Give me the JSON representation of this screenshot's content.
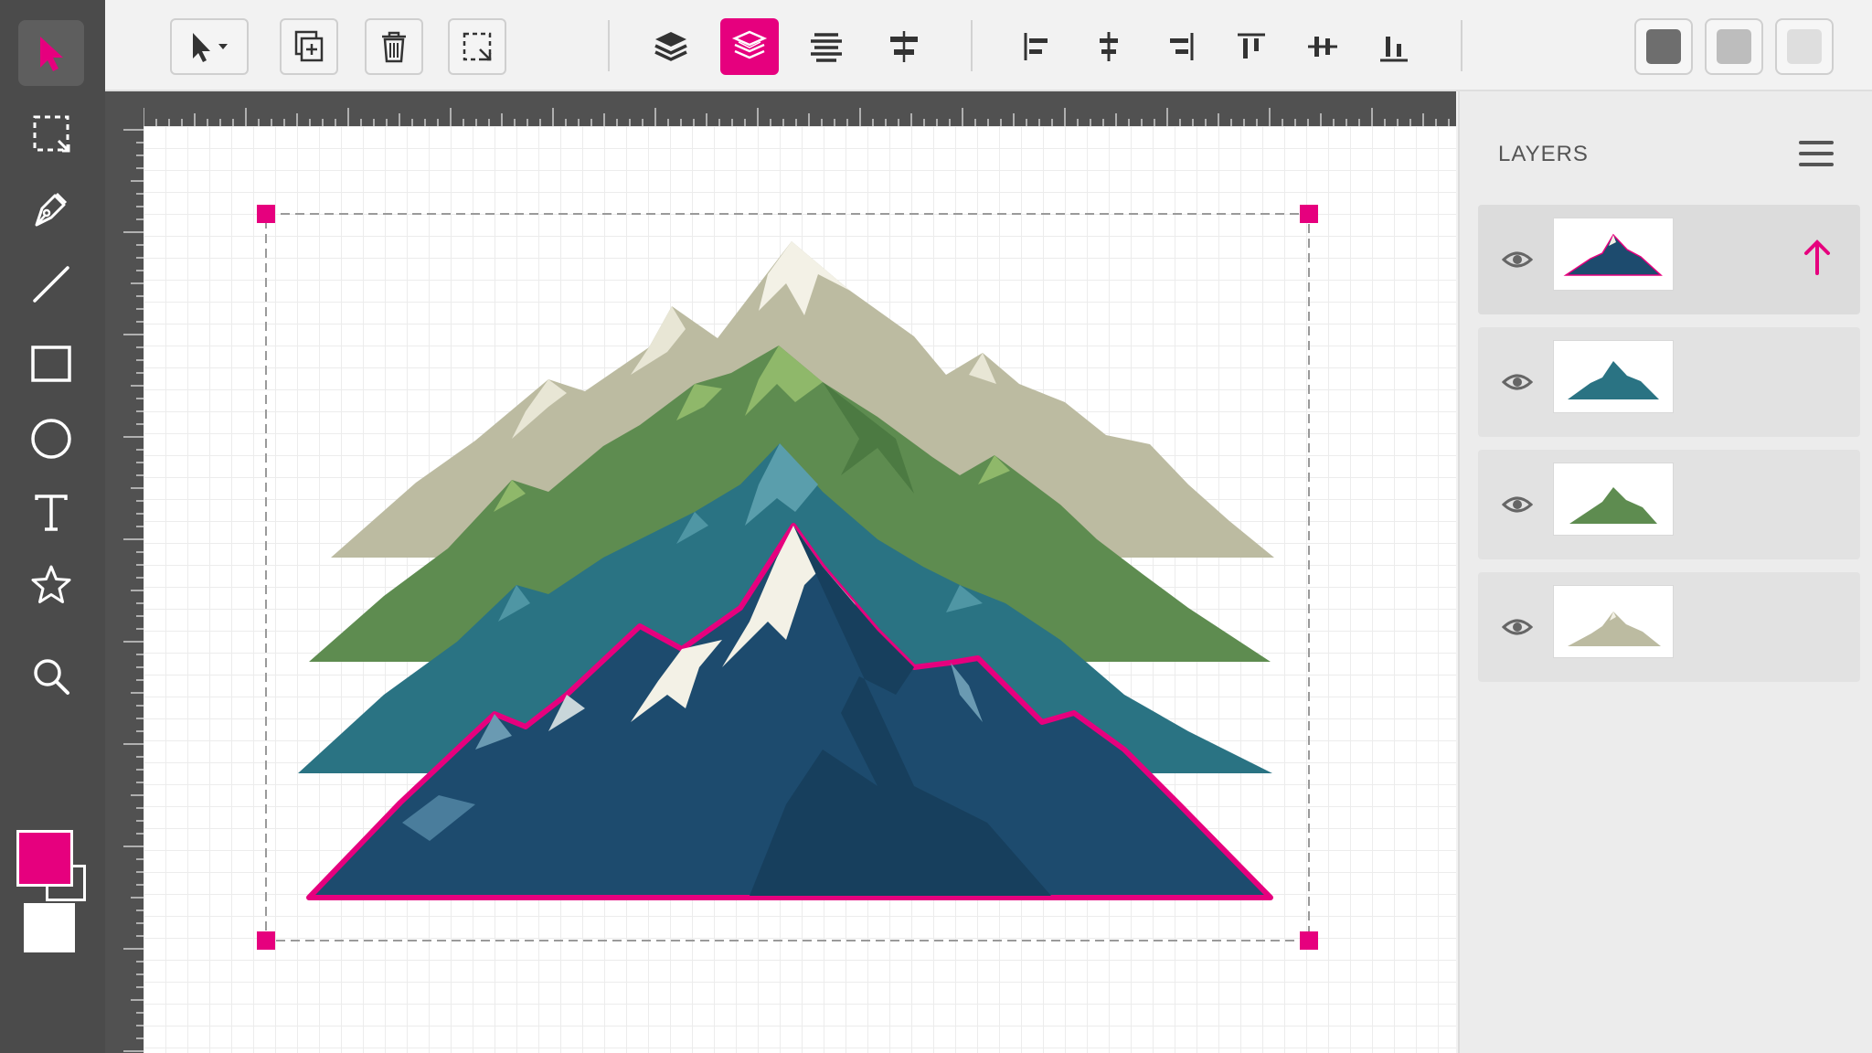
{
  "left_toolbar": {
    "tools": [
      {
        "name": "select-tool",
        "icon": "arrow-pointer-icon",
        "active": true
      },
      {
        "name": "marquee-tool",
        "icon": "marquee-select-icon"
      },
      {
        "name": "pen-tool",
        "icon": "pen-nib-icon"
      },
      {
        "name": "line-tool",
        "icon": "line-icon"
      },
      {
        "name": "rectangle-tool",
        "icon": "rectangle-icon"
      },
      {
        "name": "ellipse-tool",
        "icon": "circle-icon"
      },
      {
        "name": "text-tool",
        "icon": "text-t-icon"
      },
      {
        "name": "star-tool",
        "icon": "star-icon"
      },
      {
        "name": "zoom-tool",
        "icon": "magnifier-icon"
      }
    ],
    "fill_color": "#e6007e",
    "stroke_color": "#ffffff"
  },
  "top_toolbar": {
    "groups": [
      [
        "pointer-dropdown-icon",
        "duplicate-icon",
        "delete-trash-icon",
        "select-region-icon"
      ],
      [
        "layers-stack-icon",
        "layer-selected-icon",
        "align-center-lines-icon",
        "distribute-center-icon"
      ],
      [
        "align-left-icon",
        "align-horizontal-center-icon",
        "align-right-icon",
        "align-top-icon",
        "align-vertical-center-icon",
        "align-bottom-icon"
      ],
      [
        "dark-gray-shade-icon",
        "medium-gray-shade-icon",
        "light-gray-shade-icon"
      ]
    ],
    "accent_color": "#e6007e",
    "shades": [
      "#6e6e6e",
      "#bdbdbd",
      "#dedede"
    ]
  },
  "layers_panel": {
    "title": "LAYERS",
    "layers": [
      {
        "name": "navy-mountain-layer",
        "color": "#1e4a6b",
        "visible": true,
        "selected": true
      },
      {
        "name": "teal-mountain-layer",
        "color": "#2b7082",
        "visible": true
      },
      {
        "name": "green-mountain-layer",
        "color": "#5b8a4f",
        "visible": true
      },
      {
        "name": "beige-mountain-layer",
        "color": "#bdbba2",
        "visible": true
      }
    ]
  },
  "canvas": {
    "selection_handle_color": "#e6007e",
    "mountain_colors": {
      "beige": "#bcbba1",
      "green": "#5e8c50",
      "teal": "#2a7383",
      "navy": "#1d4b6e",
      "outline": "#e6007e",
      "snow": "#f3f1e6"
    }
  }
}
